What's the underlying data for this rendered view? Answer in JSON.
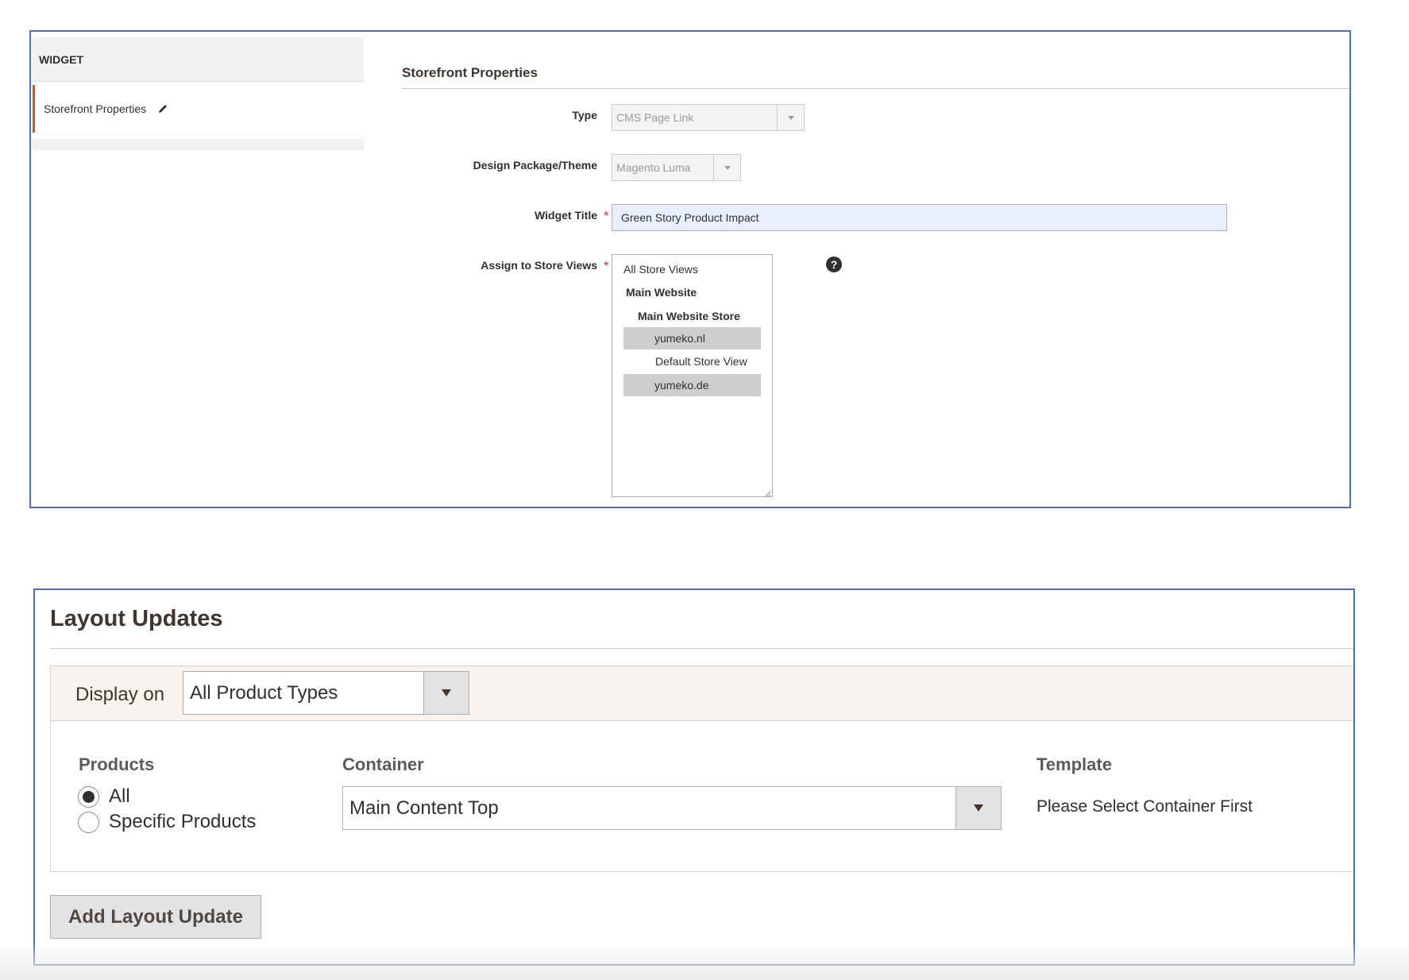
{
  "widget_panel": {
    "sidebar": {
      "heading": "WIDGET",
      "active_item": "Storefront Properties"
    },
    "section_title": "Storefront Properties",
    "fields": {
      "type": {
        "label": "Type",
        "value": "CMS Page Link"
      },
      "theme": {
        "label": "Design Package/Theme",
        "value": "Magento Luma"
      },
      "widget_title": {
        "label": "Widget Title",
        "required": "*",
        "value": "Green Story Product Impact"
      },
      "store_views": {
        "label": "Assign to Store Views",
        "required": "*",
        "help": "?",
        "options": [
          {
            "label": "All Store Views"
          },
          {
            "label": "Main Website"
          },
          {
            "label": "Main Website Store"
          },
          {
            "label": "yumeko.nl",
            "selected": true
          },
          {
            "label": "Default Store View"
          },
          {
            "label": "yumeko.de",
            "selected": true
          }
        ]
      }
    }
  },
  "layout_panel": {
    "title": "Layout Updates",
    "display_on": {
      "label": "Display on",
      "value": "All Product Types"
    },
    "columns": {
      "products": {
        "heading": "Products",
        "options": [
          {
            "label": "All",
            "checked": true
          },
          {
            "label": "Specific Products",
            "checked": false
          }
        ]
      },
      "container": {
        "heading": "Container",
        "value": "Main Content Top"
      },
      "template": {
        "heading": "Template",
        "value": "Please Select Container First"
      }
    },
    "add_button": "Add Layout Update"
  },
  "colors": {
    "panel_border": "#4f6fad",
    "active_tab_accent": "#eb5202",
    "required_star": "#e22626",
    "display_bar_bg": "#f8f3ed"
  }
}
